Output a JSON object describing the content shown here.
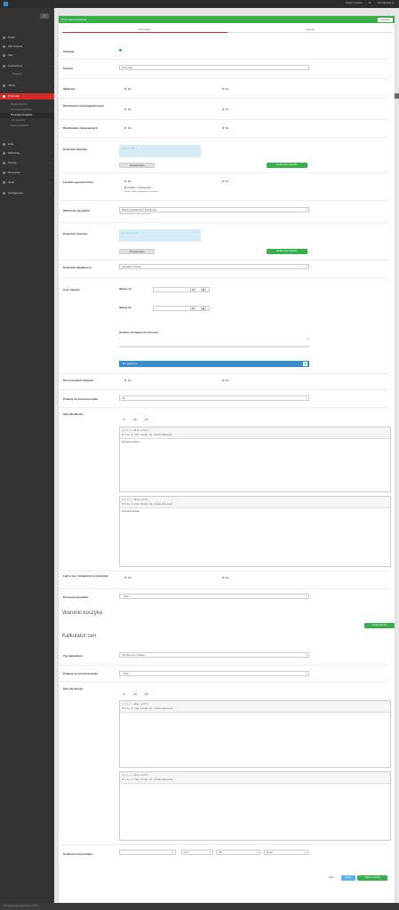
{
  "topbar": {
    "app_name": "",
    "right_items": [
      "Wyjdź z serwisu",
      "PL",
      "",
      "admin@sklep.pl"
    ]
  },
  "sidebar": {
    "items": [
      {
        "label": "Pulpit"
      },
      {
        "label": "Zamówienia"
      },
      {
        "label": "Pliki"
      },
      {
        "label": "Kontrahenci"
      },
      {
        "label": "Magazyn"
      },
      {
        "label": "Oferty"
      },
      {
        "label": "Promocje"
      },
      {
        "label": "Pola"
      },
      {
        "label": "Marketing"
      },
      {
        "label": "Moduły"
      },
      {
        "label": "Narzędzia"
      },
      {
        "label": "Dane"
      },
      {
        "label": "Konfiguracja"
      }
    ],
    "sub_items": [
      "Reguły promocji",
      "Promocje produktów",
      "Promocje koszykowe",
      "Listy promocji",
      "Kupony rabatowe"
    ]
  },
  "panel": {
    "title": "Promocja koszykowa",
    "header_button": "Operacje"
  },
  "tabs": [
    "Szczegóły",
    "Historia"
  ],
  "form": {
    "active_label": "Aktywna",
    "symbol_label": "Symbol",
    "symbol_value": "Promocja1",
    "exclusive_label": "Wyłączny",
    "include_discounted_label": "Dla klientów nieuwzględnionych",
    "include_logged_label": "Dla klientów zalogowanych",
    "clients_criterion_label": "Kryterium klientów",
    "clients_placeholder": "Wszyscy klienci",
    "clients_btn_details": "Zaawansowane",
    "clients_btn_add": "Dodaj nowe kryterium",
    "count_label": "Liczenie wg kwot brutto",
    "count_sub": "Pobierz z konfiguracji",
    "count_hint": "Wartości będą uwzględnione w walucie",
    "currency_label": "Obliczenie wg waluty",
    "currency_value": "Waluta podstawowa z konfiguracji",
    "currency_hint": "Wartości będą przeliczone wg kursu",
    "products_criterion_label": "Kryterium towarów",
    "products_placeholder": "Wszystkie towary",
    "products_btn_details": "Zaawansowane",
    "products_btn_add": "Dodaj nowe kryterium",
    "action_criterion_label": "Kryterium działania na",
    "action_criterion_value": "wszystkie produkty",
    "duration_label": "Czas trwania",
    "valid_from_label": "Ważne od",
    "valid_to_label": "Ważne do",
    "hours_label": "Godziny dostępności promocji",
    "slider_min": "0",
    "slider_max": "23",
    "all_hours_label": "Bez ograniczeń",
    "all_warehouses_label": "Dla wszystkich sklepów",
    "show_in_cart_label": "Pokazuj na stronie koszyka",
    "show_in_cart_value": "Tak",
    "client_desc_label": "Opis dla klienta",
    "langs": [
      "PL",
      "DE",
      "EN"
    ],
    "editor1_text": "Darmowa dostawa",
    "editor2_text": "Darmowa dostawa",
    "combine_label": "Łączy się z następnymi promocjami",
    "special_label": "Promocja specjalna",
    "special_value": "-- Brak --",
    "yes": "Tak",
    "no": "Nie"
  },
  "cart_conditions": {
    "heading": "Warunki koszyka",
    "add_btn": "Dodaj warunek"
  },
  "calculator": {
    "heading": "Kalkulator cen",
    "type_label": "Typ kalkulatora",
    "type_value": "Obniżka ceny dostawy",
    "show_label": "Pokazuj na stronie koszyka",
    "show_value": "-- Brak --",
    "desc_label": "Opis dla klienta",
    "editor_text": "",
    "cap_label": "Ustalona cena dostawy",
    "cap_value": "0",
    "cap_unit": "PLN",
    "cap_mode": "Z/N",
    "cap_extra": "Brutto"
  },
  "actions": {
    "back": "Wróć",
    "save": "Zapisz",
    "save_close": "Zapisz i zamknij"
  },
  "footer": "Wszelkie prawa zastrzeżone © 2024"
}
